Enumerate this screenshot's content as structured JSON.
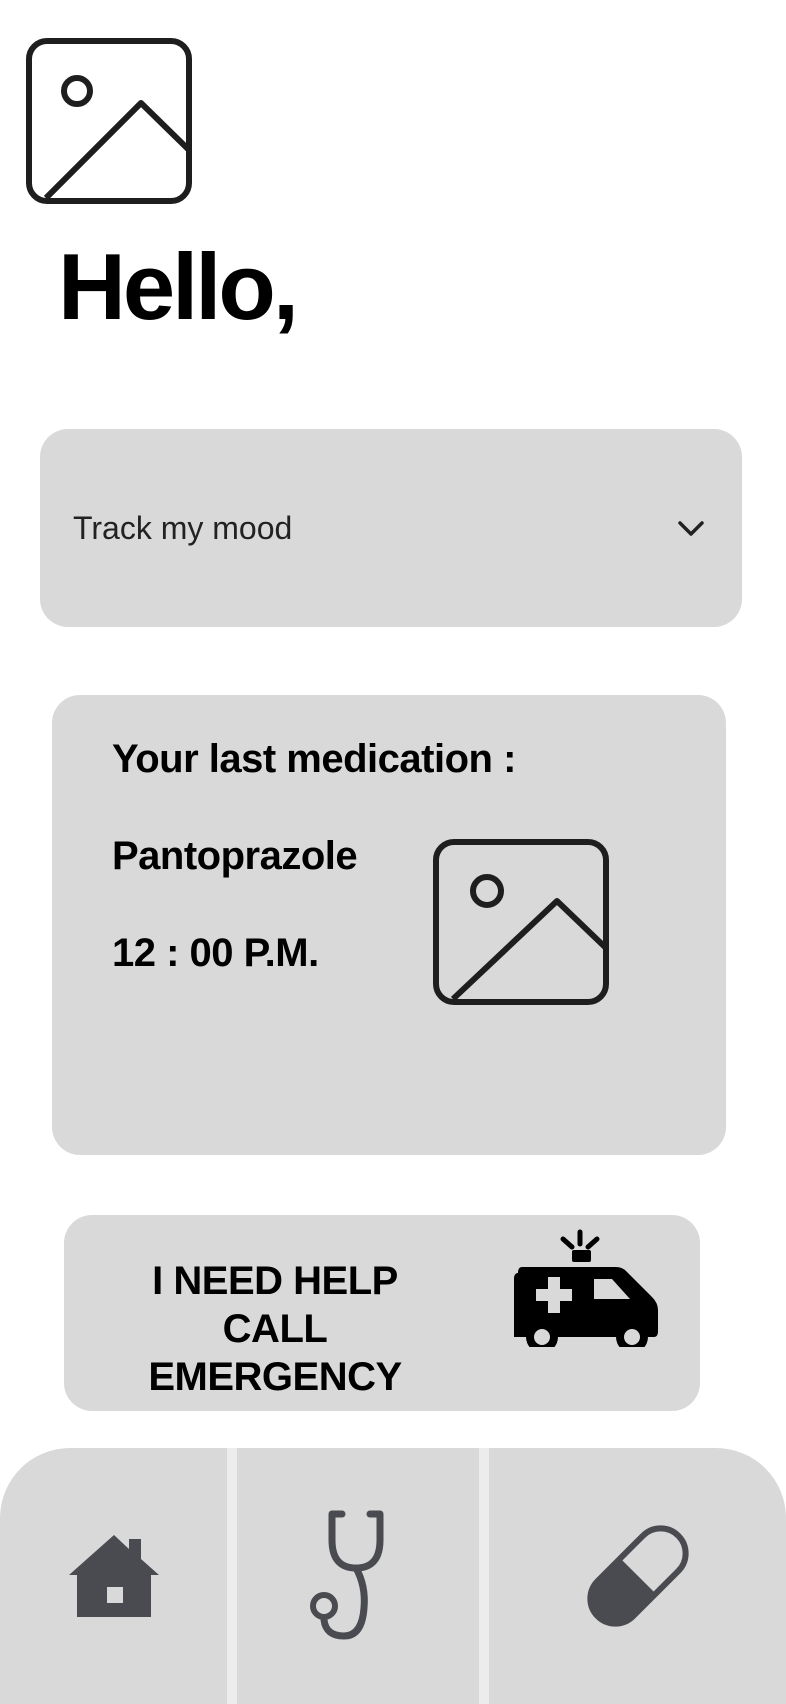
{
  "header": {
    "avatar_icon": "image-placeholder-icon",
    "greeting": "Hello,"
  },
  "mood": {
    "label": "Track my mood",
    "icon": "chevron-down-icon"
  },
  "medication": {
    "heading": "Your last medication :",
    "name": "Pantoprazole",
    "time": "12 : 00 P.M.",
    "image_icon": "image-placeholder-icon"
  },
  "emergency": {
    "line1": "I NEED HELP",
    "line2": "CALL EMERGENCY",
    "icon": "ambulance-icon"
  },
  "bottom_nav": {
    "items": [
      {
        "icon": "home-icon"
      },
      {
        "icon": "stethoscope-icon"
      },
      {
        "icon": "pill-icon"
      }
    ],
    "icon_color": "#4a4b50",
    "background": "#d9d9d9"
  }
}
